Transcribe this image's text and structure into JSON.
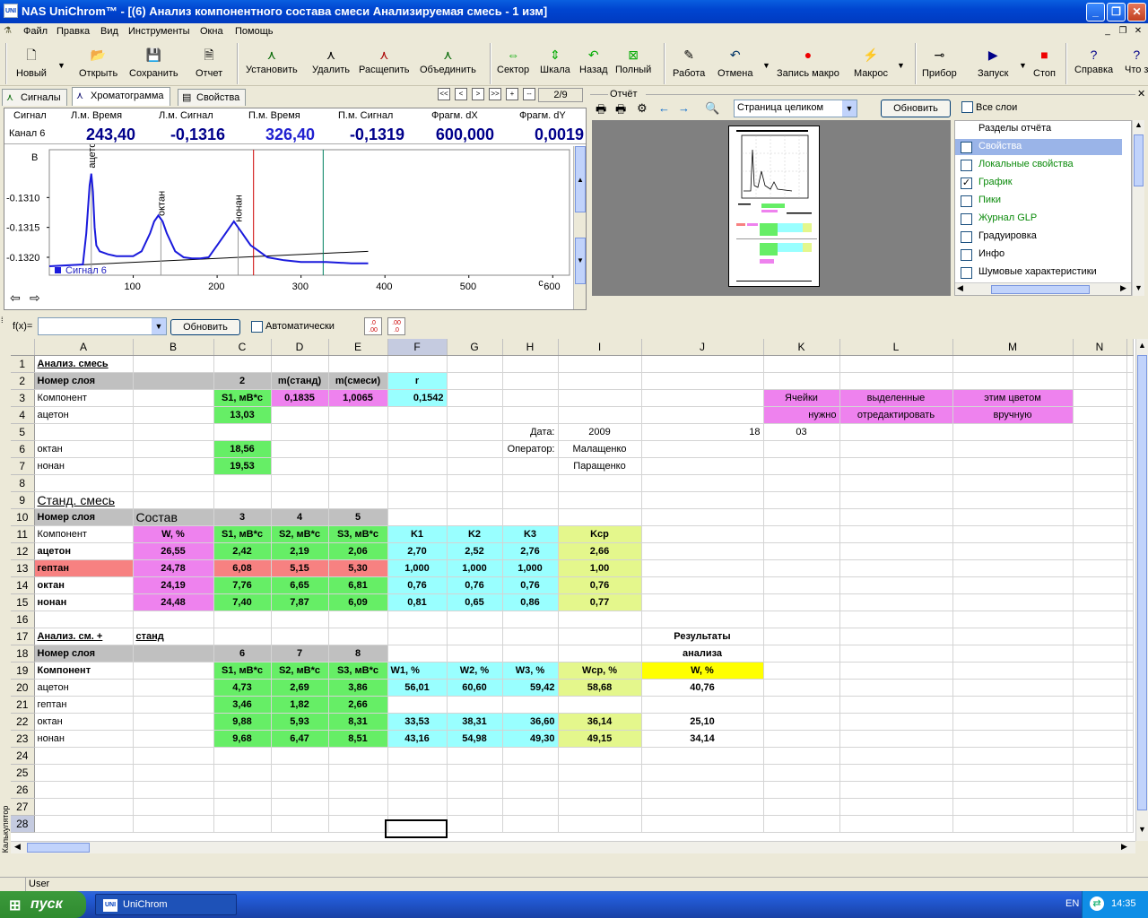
{
  "window": {
    "app_icon": "UNI",
    "title": "NAS UniChrom™ - [(6) Анализ компонентного состава смеси Анализируемая смесь - 1 изм]"
  },
  "menu": [
    "Файл",
    "Правка",
    "Вид",
    "Инструменты",
    "Окна",
    "Помощь"
  ],
  "toolbar": {
    "new": "Новый",
    "open": "Открыть",
    "save": "Сохранить",
    "report": "Отчет",
    "set": "Установить",
    "delete": "Удалить",
    "split": "Расщепить",
    "merge": "Объединить",
    "sector": "Сектор",
    "scale": "Шкала",
    "back": "Назад",
    "full": "Полный",
    "work": "Работа",
    "undo": "Отмена",
    "record_macro": "Запись макро",
    "macro": "Макрос",
    "device": "Прибор",
    "start": "Запуск",
    "stop": "Стоп",
    "help": "Справка",
    "whats_this": "Что з"
  },
  "chrom": {
    "tabs": [
      "Сигналы",
      "Хроматограмма",
      "Свойства"
    ],
    "nav": [
      "<<",
      "<",
      ">",
      ">>",
      "+",
      "--"
    ],
    "page": "2/9",
    "headers": [
      "Сигнал",
      "Л.м. Время",
      "Л.м. Сигнал",
      "П.м. Время",
      "П.м. Сигнал",
      "Фрагм. dX",
      "Фрагм. dY"
    ],
    "channel": "Канал 6",
    "values": [
      "243,40",
      "-0,1316",
      "326,40",
      "-0,1319",
      "600,000",
      "0,0019"
    ],
    "y_unit": "В",
    "x_unit": "с",
    "legend": "Сигнал 6"
  },
  "chart_data": {
    "type": "line",
    "title": "",
    "xlabel": "с",
    "ylabel": "В",
    "xlim": [
      0,
      620
    ],
    "ylim": [
      -0.1323,
      -0.1302
    ],
    "x_ticks": [
      "100",
      "200",
      "300",
      "400",
      "500",
      "600"
    ],
    "y_ticks": [
      "-0.1310",
      "-0.1315",
      "-0.1320"
    ],
    "series": [
      {
        "name": "Сигнал 6",
        "x": [
          0,
          40,
          44,
          48,
          50,
          52,
          54,
          56,
          60,
          70,
          80,
          100,
          110,
          120,
          125,
          130,
          135,
          140,
          150,
          160,
          170,
          180,
          190,
          200,
          210,
          215,
          220,
          225,
          230,
          235,
          240,
          250,
          260,
          280,
          300,
          330,
          360,
          380
        ],
        "y": [
          -0.13215,
          -0.13212,
          -0.1316,
          -0.1308,
          -0.1306,
          -0.1309,
          -0.1315,
          -0.1318,
          -0.1319,
          -0.13195,
          -0.13198,
          -0.13198,
          -0.1319,
          -0.1316,
          -0.1314,
          -0.1313,
          -0.1314,
          -0.1316,
          -0.1319,
          -0.132,
          -0.13202,
          -0.13202,
          -0.132,
          -0.1318,
          -0.1316,
          -0.1315,
          -0.1314,
          -0.1315,
          -0.1316,
          -0.1317,
          -0.1318,
          -0.1319,
          -0.132,
          -0.13205,
          -0.13208,
          -0.13208,
          -0.1321,
          -0.1321
        ]
      }
    ],
    "baseline": {
      "x": [
        0,
        380
      ],
      "y": [
        -0.13215,
        -0.1319
      ]
    },
    "peaks": [
      {
        "name": "ацетон",
        "x": 50
      },
      {
        "name": "октан",
        "x": 133
      },
      {
        "name": "нонан",
        "x": 225
      }
    ],
    "markers": [
      {
        "x": 243.4,
        "color": "#cc0000"
      },
      {
        "x": 326.4,
        "color": "#008060"
      }
    ],
    "grid": false
  },
  "report": {
    "label": "Отчёт",
    "zoom": "Страница целиком",
    "refresh": "Обновить",
    "all_layers": "Все слои",
    "sections_title": "Разделы отчёта",
    "sections": [
      {
        "label": "Свойства",
        "checked": false,
        "selected": true
      },
      {
        "label": "Локальные свойства",
        "checked": false
      },
      {
        "label": "График",
        "checked": true
      },
      {
        "label": "Пики",
        "checked": false
      },
      {
        "label": "Журнал GLP",
        "checked": false
      },
      {
        "label": "Градуировка",
        "checked": false,
        "black": true
      },
      {
        "label": "Инфо",
        "checked": false,
        "black": true
      },
      {
        "label": "Шумовые характеристики",
        "checked": false,
        "black": true
      }
    ]
  },
  "formula": {
    "label": "f(x)=",
    "refresh": "Обновить",
    "auto": "Автоматически"
  },
  "sheet": {
    "columns": [
      "A",
      "B",
      "C",
      "D",
      "E",
      "F",
      "G",
      "H",
      "I",
      "J",
      "K",
      "L",
      "M",
      "N"
    ],
    "rows": {
      "1": {
        "A": "Анализ. смесь"
      },
      "2": {
        "A": "Номер слоя",
        "C": "2",
        "D": "m(станд)",
        "E": "m(смеси)",
        "F": "r"
      },
      "3": {
        "A": "Компонент",
        "C": "S1, мВ*с",
        "D": "0,1835",
        "E": "1,0065",
        "F": "0,1542",
        "K": "Ячейки",
        "L": "выделенные",
        "M": "этим цветом"
      },
      "4": {
        "A": "ацетон",
        "C": "13,03",
        "K": "нужно",
        "L": "отредактировать",
        "M": "вручную"
      },
      "5": {
        "H": "Дата:",
        "I": "2009",
        "J": "18",
        "K": "03"
      },
      "6": {
        "A": "октан",
        "C": "18,56",
        "H": "Оператор:",
        "I": "Малащенко"
      },
      "7": {
        "A": "нонан",
        "C": "19,53",
        "I": "Паращенко"
      },
      "9": {
        "A": "Станд. смесь"
      },
      "10": {
        "A": "Номер слоя",
        "B": "Состав",
        "C": "3",
        "D": "4",
        "E": "5"
      },
      "11": {
        "A": "Компонент",
        "B": "W, %",
        "C": "S1, мВ*с",
        "D": "S2, мВ*с",
        "E": "S3, мВ*с",
        "F": "K1",
        "G": "K2",
        "H": "K3",
        "I": "Kср"
      },
      "12": {
        "A": "ацетон",
        "B": "26,55",
        "C": "2,42",
        "D": "2,19",
        "E": "2,06",
        "F": "2,70",
        "G": "2,52",
        "H": "2,76",
        "I": "2,66"
      },
      "13": {
        "A": "гептан",
        "B": "24,78",
        "C": "6,08",
        "D": "5,15",
        "E": "5,30",
        "F": "1,000",
        "G": "1,000",
        "H": "1,000",
        "I": "1,00"
      },
      "14": {
        "A": "октан",
        "B": "24,19",
        "C": "7,76",
        "D": "6,65",
        "E": "6,81",
        "F": "0,76",
        "G": "0,76",
        "H": "0,76",
        "I": "0,76"
      },
      "15": {
        "A": "нонан",
        "B": "24,48",
        "C": "7,40",
        "D": "7,87",
        "E": "6,09",
        "F": "0,81",
        "G": "0,65",
        "H": "0,86",
        "I": "0,77"
      },
      "17": {
        "A": "Анализ. см. +",
        "B": "станд",
        "J": "Результаты"
      },
      "18": {
        "A": "Номер слоя",
        "C": "6",
        "D": "7",
        "E": "8",
        "J": "анализа"
      },
      "19": {
        "A": "Компонент",
        "C": "S1, мВ*с",
        "D": "S2, мВ*с",
        "E": "S3, мВ*с",
        "F": "W1, %",
        "G": "W2, %",
        "H": "W3, %",
        "I": "Wср, %",
        "J": "W, %"
      },
      "20": {
        "A": "ацетон",
        "C": "4,73",
        "D": "2,69",
        "E": "3,86",
        "F": "56,01",
        "G": "60,60",
        "H": "59,42",
        "I": "58,68",
        "J": "40,76"
      },
      "21": {
        "A": "гептан",
        "C": "3,46",
        "D": "1,82",
        "E": "2,66"
      },
      "22": {
        "A": "октан",
        "C": "9,88",
        "D": "5,93",
        "E": "8,31",
        "F": "33,53",
        "G": "38,31",
        "H": "36,60",
        "I": "36,14",
        "J": "25,10"
      },
      "23": {
        "A": "нонан",
        "C": "9,68",
        "D": "6,47",
        "E": "8,51",
        "F": "43,16",
        "G": "54,98",
        "H": "49,30",
        "I": "49,15",
        "J": "34,14"
      }
    }
  },
  "side_label": "Калькулятор",
  "status": {
    "user": "User"
  },
  "taskbar": {
    "start": "пуск",
    "app_icon": "UNI",
    "app": "UniChrom",
    "lang": "EN",
    "time": "14:35"
  },
  "colors": {
    "green": "#66ee66",
    "pink": "#ee82ee",
    "cyan": "#99ffff",
    "lime": "#e4f78c",
    "red": "#f78181",
    "yellow": "#ffff00",
    "gray": "#c0c0c0",
    "signal": "#1a1adc"
  }
}
